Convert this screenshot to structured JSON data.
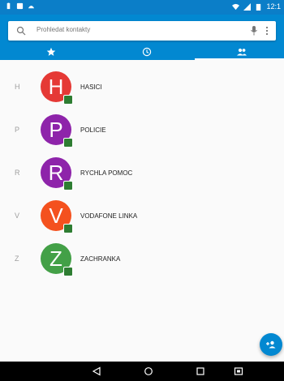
{
  "status_bar": {
    "left_icons": [
      "notification-icon",
      "message-icon",
      "android-debug-icon"
    ],
    "right_icons": [
      "wifi-icon",
      "signal-icon",
      "battery-icon"
    ],
    "time": "12:1"
  },
  "search": {
    "placeholder": "Prohledat kontakty",
    "icons": [
      "search-icon",
      "mic-icon",
      "more-vert-icon"
    ]
  },
  "tabs": [
    {
      "icon": "star-icon",
      "name": "favorites"
    },
    {
      "icon": "clock-icon",
      "name": "recents"
    },
    {
      "icon": "people-icon",
      "name": "contacts",
      "selected": true
    }
  ],
  "contacts": [
    {
      "section": "H",
      "initial": "H",
      "name": "HASICI",
      "color": "#e53935"
    },
    {
      "section": "P",
      "initial": "P",
      "name": "POLICIE",
      "color": "#8e24aa"
    },
    {
      "section": "R",
      "initial": "R",
      "name": "RYCHLA POMOC",
      "color": "#8e24aa"
    },
    {
      "section": "V",
      "initial": "V",
      "name": "VODAFONE LINKA",
      "color": "#f4511e"
    },
    {
      "section": "Z",
      "initial": "Z",
      "name": "ZACHRANKA",
      "color": "#43a047"
    }
  ],
  "fab": {
    "icon": "add-contact-icon",
    "color": "#0288d1"
  },
  "nav_bar": [
    "back-icon",
    "home-icon",
    "recents-icon",
    "screenshot-icon"
  ],
  "colors": {
    "primary": "#0288d1",
    "status_bar": "#0b7ec8"
  }
}
